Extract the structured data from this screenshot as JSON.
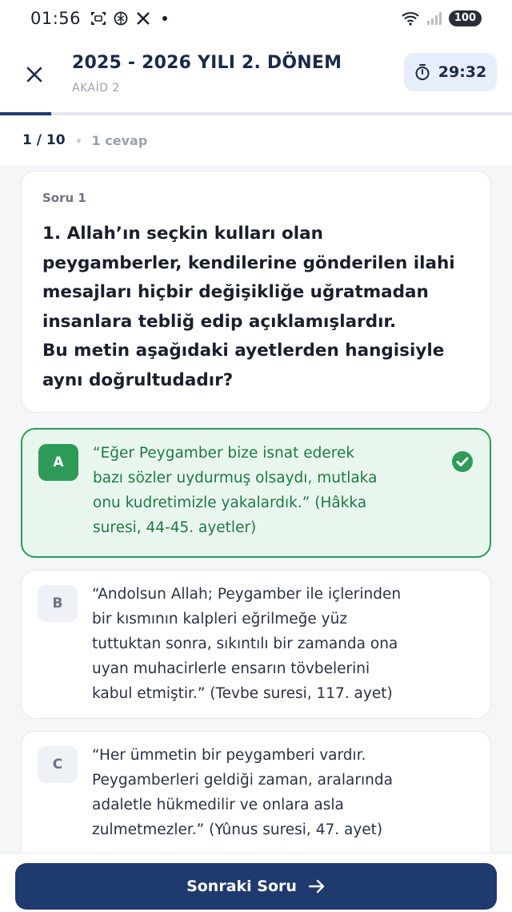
{
  "status_bar": {
    "time": "01:56",
    "battery": "100",
    "icons": [
      "screenshot-icon",
      "openai-icon",
      "x-icon",
      "dot-icon",
      "wifi-icon",
      "signal-icon",
      "battery-icon"
    ]
  },
  "header": {
    "title": "2025 - 2026 YILI 2. DÖNEM",
    "subtitle": "AKAİD 2",
    "timer": "29:32"
  },
  "progress": {
    "fraction": 0.1
  },
  "counter": {
    "position": "1 / 10",
    "answers": "1 cevap"
  },
  "question": {
    "label": "Soru 1",
    "text": "1. Allah’ın seçkin kulları olan\npeygamberler, kendilerine gönderilen ilahi\nmesajları hiçbir değişikliğe uğratmadan\ninsanlara tebliğ edip açıklamışlardır.\nBu metin aşağıdaki ayetlerden hangisiyle\naynı doğrultudadır?"
  },
  "options": [
    {
      "letter": "A",
      "text": "“Eğer Peygamber bize isnat ederek\nbazı sözler uydurmuş olsaydı, mutlaka\nonu kudretimizle yakalardık.” (Hâkka\nsuresi, 44-45. ayetler)",
      "selected": true
    },
    {
      "letter": "B",
      "text": "“Andolsun Allah; Peygamber ile içlerinden\nbir kısmının kalpleri eğrilmeğe yüz\ntuttuktan sonra, sıkıntılı bir zamanda ona\nuyan muhacirlerle ensarın tövbelerini\nkabul etmiştir.” (Tevbe suresi, 117. ayet)",
      "selected": false
    },
    {
      "letter": "C",
      "text": "“Her ümmetin bir peygamberi vardır.\nPeygamberleri geldiği zaman, aralarında\nadaletle hükmedilir ve onlara asla\nzulmetmezler.” (Yûnus suresi, 47. ayet)",
      "selected": false
    }
  ],
  "footer": {
    "next_label": "Sonraki Soru"
  },
  "colors": {
    "primary": "#1f3a6e",
    "correct": "#2e9a58",
    "correct_bg": "#e9f6ee",
    "timer_bg": "#e6eefb"
  }
}
